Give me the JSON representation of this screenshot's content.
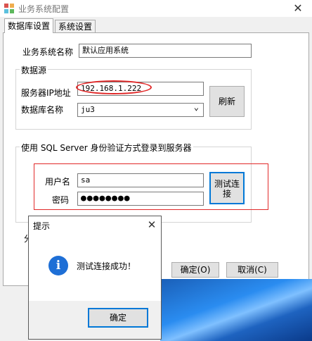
{
  "window": {
    "title": "业务系统配置",
    "close_glyph": "✕"
  },
  "tabs": [
    {
      "label": "数据库设置",
      "active": true
    },
    {
      "label": "系统设置",
      "active": false
    }
  ],
  "business_system": {
    "label": "业务系统名称",
    "value": "默认应用系统"
  },
  "datasource": {
    "group_title": "数据源",
    "server_ip_label": "服务器IP地址",
    "server_ip_value": "192.168.1.222",
    "db_name_label": "数据库名称",
    "db_name_value": "ju3",
    "dropdown_glyph": "⌄",
    "refresh_label": "刷新"
  },
  "sql_auth": {
    "group_title": "使用 SQL Server 身份验证方式登录到服务器",
    "username_label": "用户名",
    "username_value": "sa",
    "password_label": "密码",
    "password_value": "●●●●●●●●",
    "test_connection_label_line1": "测试连",
    "test_connection_label_line2": "接"
  },
  "footer": {
    "ok_label": "确定(O)",
    "cancel_label": "取消(C)",
    "partial_glyph": "分"
  },
  "dialog": {
    "title": "提示",
    "close_glyph": "✕",
    "icon_glyph": "i",
    "message": "测试连接成功！",
    "ok_label": "确定"
  },
  "colors": {
    "annotation": "#e12a2a",
    "info_icon": "#1e6fd6",
    "focus_border": "#0078d7"
  }
}
